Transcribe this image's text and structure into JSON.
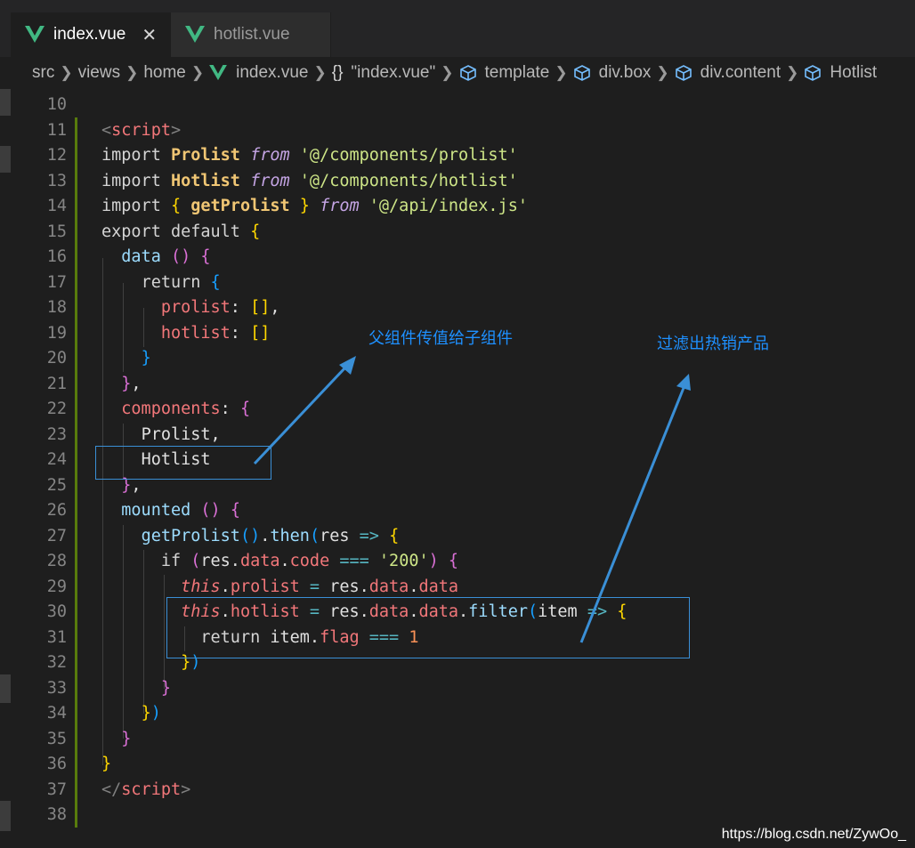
{
  "tabs": [
    {
      "label": "index.vue",
      "active": true
    },
    {
      "label": "hotlist.vue",
      "active": false
    }
  ],
  "breadcrumb": {
    "segments": [
      "src",
      "views",
      "home"
    ],
    "file": "index.vue",
    "braces": "{}",
    "module": "\"index.vue\"",
    "symbols": [
      "template",
      "div.box",
      "div.content",
      "Hotlist"
    ]
  },
  "line_numbers": [
    "10",
    "11",
    "12",
    "13",
    "14",
    "15",
    "16",
    "17",
    "18",
    "19",
    "20",
    "21",
    "22",
    "23",
    "24",
    "25",
    "26",
    "27",
    "28",
    "29",
    "30",
    "31",
    "32",
    "33",
    "34",
    "35",
    "36",
    "37",
    "38"
  ],
  "annotations": {
    "parent_to_child": "父组件传值给子组件",
    "filter_hot": "过滤出热销产品"
  },
  "watermark": "https://blog.csdn.net/ZywOo_",
  "colors": {
    "accent_vue": "#41b883",
    "annotation": "#1e90ff",
    "highlight_box": "#3a8fd6",
    "modified_bar": "#587c0c"
  }
}
